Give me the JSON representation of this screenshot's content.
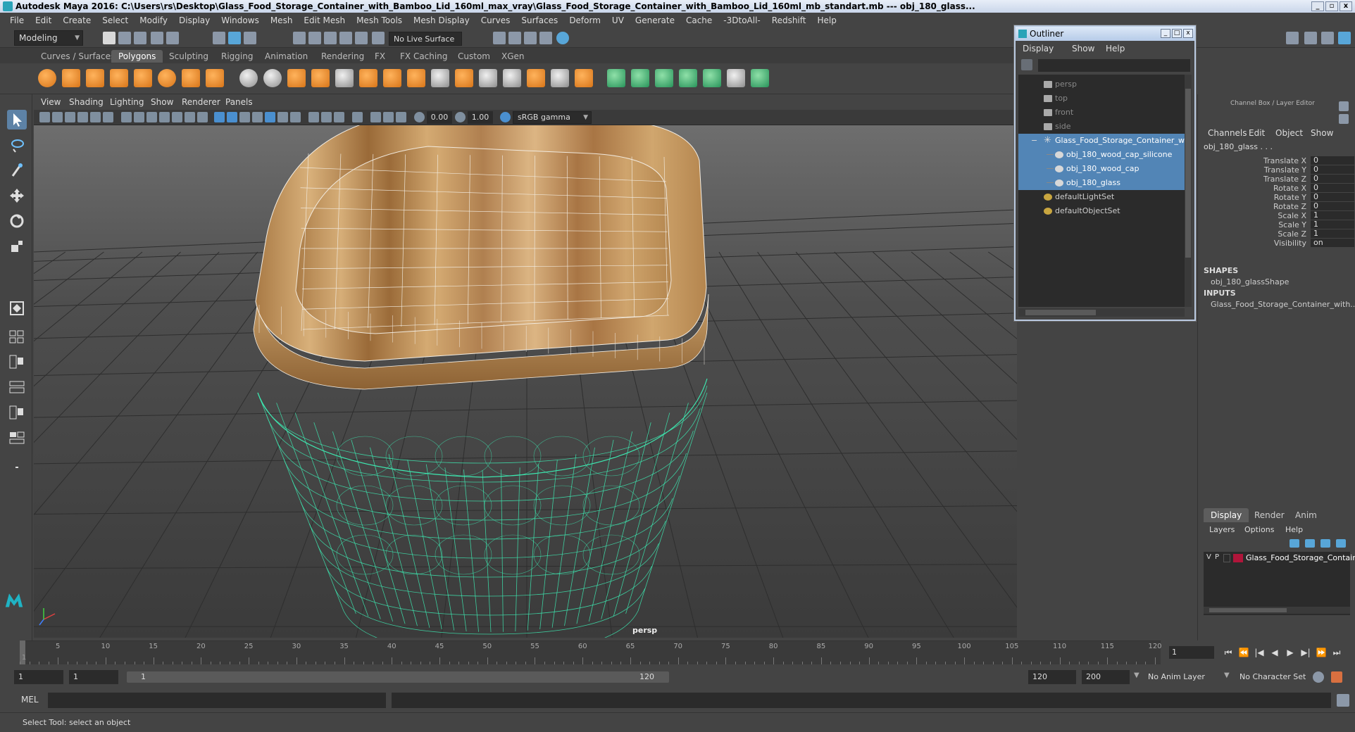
{
  "window": {
    "title": "Autodesk Maya 2016: C:\\Users\\rs\\Desktop\\Glass_Food_Storage_Container_with_Bamboo_Lid_160ml_max_vray\\Glass_Food_Storage_Container_with_Bamboo_Lid_160ml_mb_standart.mb   ---   obj_180_glass...",
    "minimize": "_",
    "maximize": "▫",
    "close": "x"
  },
  "menubar": [
    "File",
    "Edit",
    "Create",
    "Select",
    "Modify",
    "Display",
    "Windows",
    "Mesh",
    "Edit Mesh",
    "Mesh Tools",
    "Mesh Display",
    "Curves",
    "Surfaces",
    "Deform",
    "UV",
    "Generate",
    "Cache",
    "-3DtoAll-",
    "Redshift",
    "Help"
  ],
  "statusline": {
    "mode": "Modeling",
    "live_surface": "No Live Surface"
  },
  "shelf": {
    "tabs": [
      "Curves / Surfaces",
      "Polygons",
      "Sculpting",
      "Rigging",
      "Animation",
      "Rendering",
      "FX",
      "FX Caching",
      "Custom",
      "XGen"
    ],
    "active_tab": "Polygons"
  },
  "viewport": {
    "menu": [
      "View",
      "Shading",
      "Lighting",
      "Show",
      "Renderer",
      "Panels"
    ],
    "exposure": "0.00",
    "gamma": "1.00",
    "color_space": "sRGB gamma",
    "camera_label": "persp"
  },
  "outliner": {
    "title": "Outliner",
    "menu": [
      "Display",
      "Show",
      "Help"
    ],
    "items": [
      {
        "label": "persp",
        "type": "camera",
        "indent": 1,
        "dim": true
      },
      {
        "label": "top",
        "type": "camera",
        "indent": 1,
        "dim": true
      },
      {
        "label": "front",
        "type": "camera",
        "indent": 1,
        "dim": true
      },
      {
        "label": "side",
        "type": "camera",
        "indent": 1,
        "dim": true
      },
      {
        "label": "Glass_Food_Storage_Container_w",
        "type": "group",
        "indent": 1,
        "selected": true,
        "expander": "−"
      },
      {
        "label": "obj_180_wood_cap_silicone",
        "type": "mesh",
        "indent": 2,
        "selected": true
      },
      {
        "label": "obj_180_wood_cap",
        "type": "mesh",
        "indent": 2,
        "selected": true
      },
      {
        "label": "obj_180_glass",
        "type": "mesh",
        "indent": 2,
        "selected": true
      },
      {
        "label": "defaultLightSet",
        "type": "set",
        "indent": 1
      },
      {
        "label": "defaultObjectSet",
        "type": "set",
        "indent": 1
      }
    ]
  },
  "channelbox": {
    "header": "Channel Box / Layer Editor",
    "menu": [
      "Channels",
      "Edit",
      "Object",
      "Show"
    ],
    "object_name": "obj_180_glass . . .",
    "channels": [
      {
        "label": "Translate X",
        "value": "0"
      },
      {
        "label": "Translate Y",
        "value": "0"
      },
      {
        "label": "Translate Z",
        "value": "0"
      },
      {
        "label": "Rotate X",
        "value": "0"
      },
      {
        "label": "Rotate Y",
        "value": "0"
      },
      {
        "label": "Rotate Z",
        "value": "0"
      },
      {
        "label": "Scale X",
        "value": "1"
      },
      {
        "label": "Scale Y",
        "value": "1"
      },
      {
        "label": "Scale Z",
        "value": "1"
      },
      {
        "label": "Visibility",
        "value": "on"
      }
    ],
    "shapes_header": "SHAPES",
    "shape": "obj_180_glassShape",
    "inputs_header": "INPUTS",
    "input": "Glass_Food_Storage_Container_with..."
  },
  "layer_editor": {
    "tabs": [
      "Display",
      "Render",
      "Anim"
    ],
    "active_tab": "Display",
    "menu": [
      "Layers",
      "Options",
      "Help"
    ],
    "layer": {
      "v": "V",
      "p": "P",
      "name": "Glass_Food_Storage_Contair",
      "color": "#b0153a"
    }
  },
  "timeslider": {
    "ticks": [
      5,
      10,
      15,
      20,
      25,
      30,
      35,
      40,
      45,
      50,
      55,
      60,
      65,
      70,
      75,
      80,
      85,
      90,
      95,
      100,
      105,
      110,
      115,
      120
    ],
    "start_label": "1",
    "current_frame": "1",
    "controls": [
      "⏮",
      "⏪",
      "|◀",
      "◀",
      "▶",
      "▶|",
      "⏩",
      "⏭"
    ]
  },
  "range": {
    "start": "1",
    "playback_start": "1",
    "bar_left": "1",
    "bar_right": "120",
    "playback_end": "120",
    "end": "200",
    "anim_layer": "No Anim Layer",
    "character_set": "No Character Set"
  },
  "command": {
    "lang": "MEL",
    "help": "Select Tool: select an object"
  },
  "colors": {
    "accent": "#5285b6",
    "wireframe": "#3de8b0",
    "bamboo": "#c89a5e"
  }
}
